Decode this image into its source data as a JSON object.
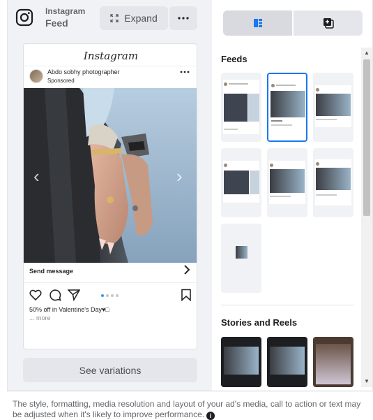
{
  "placement": {
    "platform": "Instagram",
    "position": "Feed",
    "expand_label": "Expand",
    "more_label": "More options"
  },
  "preview": {
    "header_wordmark": "Instagram",
    "account_name": "Abdo sobhy photographer",
    "sponsored_label": "Sponsored",
    "cta_label": "Send message",
    "caption": "50% off in Valentine's Day♥□",
    "more_link": "... more",
    "carousel_total": 4,
    "carousel_active": 1
  },
  "see_variations_label": "See variations",
  "toggle": {
    "options": [
      "feeds-view",
      "stories-view"
    ],
    "selected": "feeds-view"
  },
  "sections": {
    "feeds_title": "Feeds",
    "stories_title": "Stories and Reels"
  },
  "feeds_thumbs": [
    {
      "id": "feed-1",
      "selected": false
    },
    {
      "id": "feed-2",
      "selected": true
    },
    {
      "id": "feed-3",
      "selected": false
    },
    {
      "id": "feed-4",
      "selected": false
    },
    {
      "id": "feed-5",
      "selected": false
    },
    {
      "id": "feed-6",
      "selected": false
    },
    {
      "id": "feed-7",
      "selected": false
    }
  ],
  "stories_thumbs": [
    {
      "id": "story-1"
    },
    {
      "id": "story-2"
    },
    {
      "id": "story-3"
    }
  ],
  "footnote": "The style, formatting, media resolution and layout of your ad's media, call to action or text may be adjusted when it's likely to improve performance.",
  "colors": {
    "accent": "#1877f2",
    "panel_bg": "#f0f2f5",
    "button_bg": "#e4e6eb",
    "text_secondary": "#65676b"
  }
}
